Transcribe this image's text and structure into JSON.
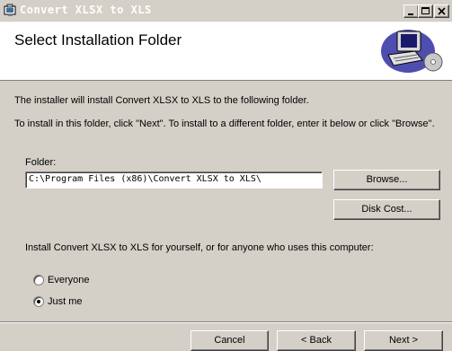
{
  "window": {
    "title": "Convert XLSX to XLS",
    "minimize_label": "_",
    "maximize_label": "□",
    "close_label": "×"
  },
  "header": {
    "title": "Select Installation Folder",
    "icon": "computer-disc-icon"
  },
  "body": {
    "intro": "The installer will install Convert XLSX to XLS to the following folder.",
    "instructions": "To install in this folder, click \"Next\". To install to a different folder, enter it below or click \"Browse\".",
    "folder_label": "Folder:",
    "folder_value": "C:\\Program Files (x86)\\Convert XLSX to XLS\\",
    "browse_label": "Browse...",
    "disk_cost_label": "Disk Cost...",
    "install_for_label": "Install Convert XLSX to XLS for yourself, or for anyone who uses this computer:",
    "options": [
      {
        "label": "Everyone",
        "selected": false
      },
      {
        "label": "Just me",
        "selected": true
      }
    ]
  },
  "footer": {
    "cancel_label": "Cancel",
    "back_label": "< Back",
    "next_label": "Next >"
  }
}
